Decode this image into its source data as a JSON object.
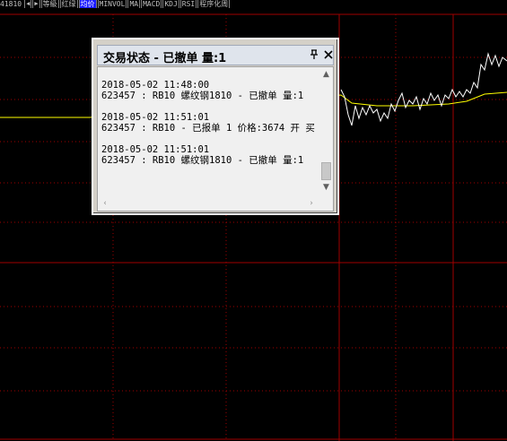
{
  "toolbar": {
    "code": "41810",
    "items": [
      {
        "label": "等級"
      },
      {
        "label": "红绿"
      },
      {
        "label": "均价"
      },
      {
        "label": "MINVOL"
      },
      {
        "label": "MA"
      },
      {
        "label": "MACD"
      },
      {
        "label": "KDJ"
      },
      {
        "label": "RSI"
      },
      {
        "label": "程序化周"
      }
    ],
    "active_index": 2
  },
  "dialog": {
    "title": "交易状态 - 已撤单 量:1",
    "pin_label": "₽",
    "close_label": "✕",
    "entries": [
      {
        "time": "2018-05-02 11:48:00",
        "line": "623457 : RB10 螺纹钢1810 - 已撤单 量:1"
      },
      {
        "time": "2018-05-02 11:51:01",
        "line": "623457 : RB10 - 已报单 1 价格:3674 开 买"
      },
      {
        "time": "2018-05-02 11:51:01",
        "line": "623457 : RB10 螺纹钢1810 - 已撤单 量:1"
      }
    ]
  },
  "colors": {
    "background": "#000000",
    "grid_solid": "#a00000",
    "grid_dotted": "#a00000",
    "price_line": "#ffffff",
    "avg_line": "#ffff00"
  }
}
